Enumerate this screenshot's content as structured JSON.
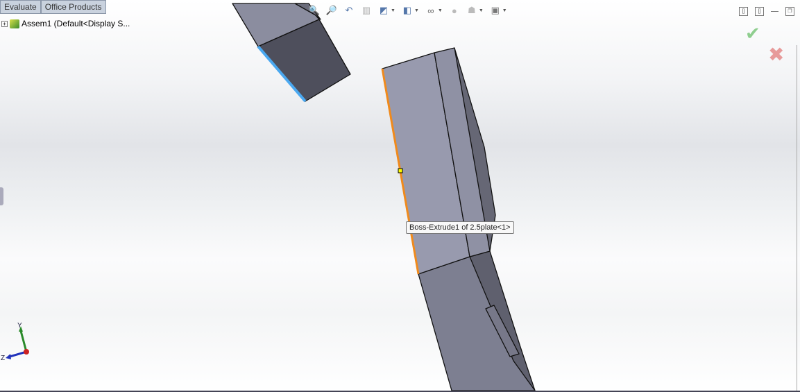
{
  "tabs": [
    {
      "label": "Evaluate"
    },
    {
      "label": "Office Products"
    }
  ],
  "tree": {
    "root_label": "Assem1  (Default<Display S..."
  },
  "tooltip": {
    "text": "Boss-Extrude1 of 2.5plate<1>"
  },
  "triad": {
    "y_label": "Y",
    "z_label": "Z"
  },
  "colors": {
    "selected_edge": "#f08a1c",
    "highlight_edge": "#4aa8f0",
    "body_face": "#9699ad",
    "dark_face": "#4c4d58"
  }
}
